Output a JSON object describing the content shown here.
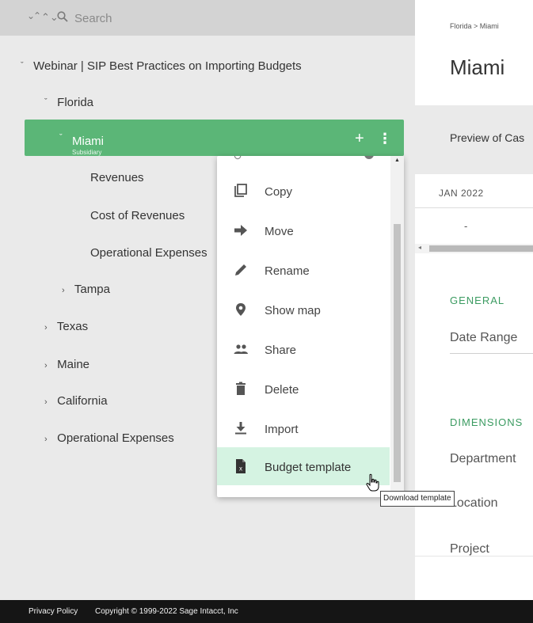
{
  "search": {
    "placeholder": "Search"
  },
  "tree": {
    "root": "Webinar | SIP Best Practices on Importing Budgets",
    "florida": "Florida",
    "miami": {
      "name": "Miami",
      "type": "Subsidiary"
    },
    "miami_children": [
      "Revenues",
      "Cost of Revenues",
      "Operational Expenses"
    ],
    "tampa": "Tampa",
    "texas": "Texas",
    "maine": "Maine",
    "california": "California",
    "operational_expenses": "Operational Expenses"
  },
  "context_menu": {
    "items": [
      {
        "label": "Copy",
        "icon": "copy-icon"
      },
      {
        "label": "Move",
        "icon": "arrow-right-icon"
      },
      {
        "label": "Rename",
        "icon": "pencil-icon"
      },
      {
        "label": "Show map",
        "icon": "map-pin-icon"
      },
      {
        "label": "Share",
        "icon": "people-icon"
      },
      {
        "label": "Delete",
        "icon": "trash-icon"
      },
      {
        "label": "Import",
        "icon": "download-icon"
      },
      {
        "label": "Budget template",
        "icon": "excel-file-icon"
      }
    ],
    "tooltip": "Download template"
  },
  "main": {
    "breadcrumb": "Florida > Miami",
    "title": "Miami",
    "preview": "Preview of Cas",
    "period": "JAN 2022",
    "value": "-",
    "general_heading": "GENERAL",
    "date_range_label": "Date Range",
    "dimensions_heading": "DIMENSIONS",
    "department_label": "Department",
    "location_label": "Location",
    "project_label": "Project"
  },
  "footer": {
    "privacy": "Privacy Policy",
    "copyright": "Copyright © 1999-2022 Sage Intacct, Inc"
  },
  "colors": {
    "accent": "#5bb677",
    "menu_hover": "#d5f3e2",
    "section_heading": "#3b9b61"
  }
}
